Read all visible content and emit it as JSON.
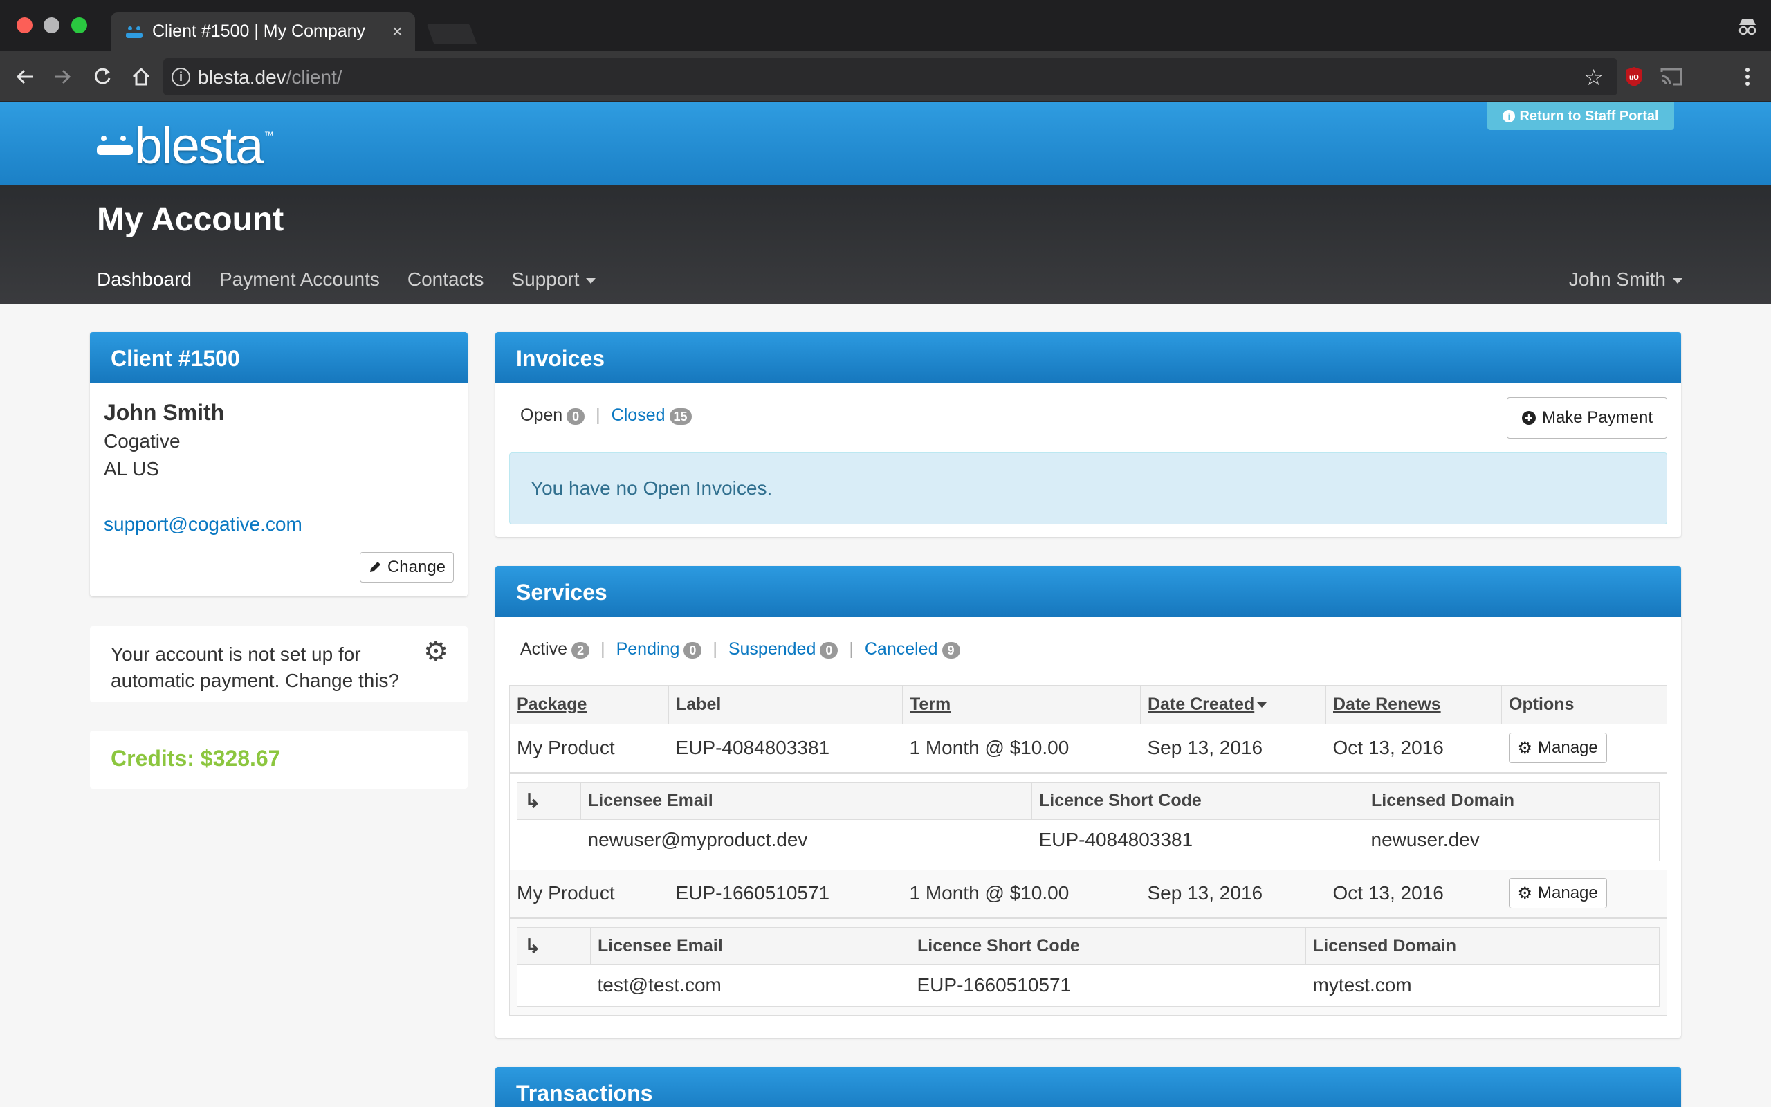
{
  "browser": {
    "tab_title": "Client #1500 | My Company",
    "tab_close": "×",
    "url_host": "blesta.dev",
    "url_path": "/client/",
    "info_icon": "i"
  },
  "site": {
    "logo_text": "blesta",
    "logo_tm": "™",
    "staff_portal_label": "Return to Staff Portal",
    "page_title": "My Account",
    "nav": [
      "Dashboard",
      "Payment Accounts",
      "Contacts",
      "Support"
    ],
    "user_menu": "John Smith"
  },
  "client": {
    "panel_title": "Client #1500",
    "name": "John Smith",
    "company": "Cogative",
    "location": "AL US",
    "email": "support@cogative.com",
    "change_label": "Change"
  },
  "autopay": {
    "text": "Your account is not set up for automatic payment. Change this?"
  },
  "credits": {
    "text": "Credits: $328.67"
  },
  "invoices": {
    "title": "Invoices",
    "filters": [
      {
        "label": "Open",
        "count": "0"
      },
      {
        "label": "Closed",
        "count": "15"
      }
    ],
    "make_payment_label": "Make Payment",
    "empty_message": "You have no Open Invoices."
  },
  "services": {
    "title": "Services",
    "filters": [
      {
        "label": "Active",
        "count": "2"
      },
      {
        "label": "Pending",
        "count": "0"
      },
      {
        "label": "Suspended",
        "count": "0"
      },
      {
        "label": "Canceled",
        "count": "9"
      }
    ],
    "columns": [
      "Package",
      "Label",
      "Term",
      "Date Created",
      "Date Renews",
      "Options"
    ],
    "manage_label": "Manage",
    "sub_columns": [
      "Licensee Email",
      "Licence Short Code",
      "Licensed Domain"
    ],
    "rows": [
      {
        "package": "My Product",
        "label": "EUP-4084803381",
        "term": "1 Month @ $10.00",
        "created": "Sep 13, 2016",
        "renews": "Oct 13, 2016",
        "license": {
          "email": "newuser@myproduct.dev",
          "code": "EUP-4084803381",
          "domain": "newuser.dev"
        }
      },
      {
        "package": "My Product",
        "label": "EUP-1660510571",
        "term": "1 Month @ $10.00",
        "created": "Sep 13, 2016",
        "renews": "Oct 13, 2016",
        "license": {
          "email": "test@test.com",
          "code": "EUP-1660510571",
          "domain": "mytest.com"
        }
      }
    ]
  },
  "transactions": {
    "title": "Transactions"
  },
  "colors": {
    "accent": "#1b80c6",
    "link": "#0a78c2",
    "credits": "#8cc63f",
    "alert_bg": "#d9edf7"
  },
  "icons": [
    "back-icon",
    "forward-icon",
    "reload-icon",
    "home-icon",
    "star-icon",
    "ublock-icon",
    "cast-icon",
    "menu-icon",
    "pencil-icon",
    "gear-icon",
    "plus-circle-icon",
    "reply-arrow-icon",
    "incognito-icon"
  ]
}
